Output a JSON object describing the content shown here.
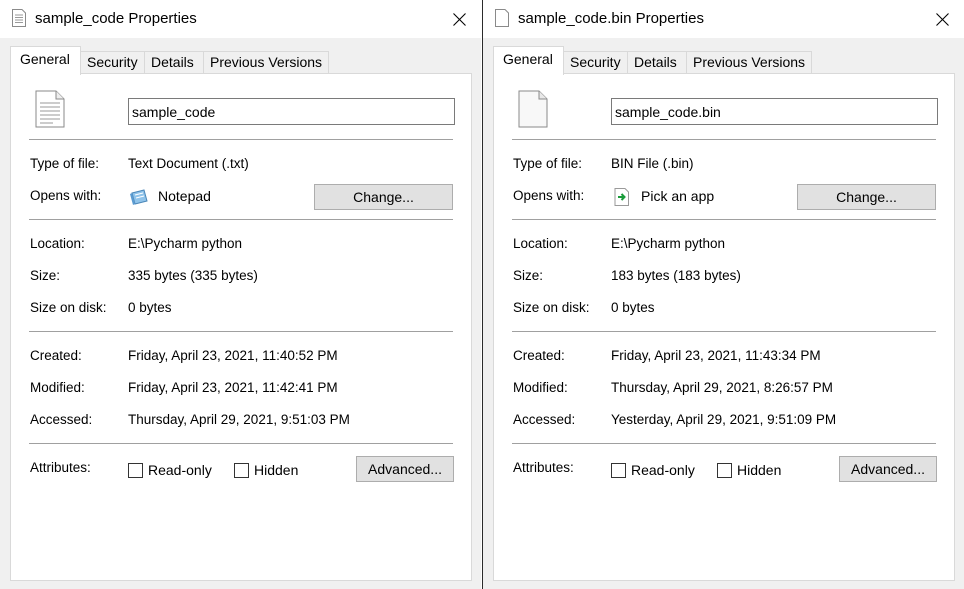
{
  "windows": [
    {
      "title": "sample_code Properties",
      "tabs": [
        "General",
        "Security",
        "Details",
        "Previous Versions"
      ],
      "file_name": "sample_code",
      "icon": "text-document-icon",
      "type_label": "Type of file:",
      "type_value": "Text Document (.txt)",
      "opens_label": "Opens with:",
      "opens_value": "Notepad",
      "opens_icon": "notepad-icon",
      "change_label": "Change...",
      "location_label": "Location:",
      "location_value": "E:\\Pycharm python",
      "size_label": "Size:",
      "size_value": "335 bytes (335 bytes)",
      "disk_label": "Size on disk:",
      "disk_value": "0 bytes",
      "created_label": "Created:",
      "created_value": "Friday, April 23, 2021, 11:40:52 PM",
      "modified_label": "Modified:",
      "modified_value": "Friday, April 23, 2021, 11:42:41 PM",
      "accessed_label": "Accessed:",
      "accessed_value": "Thursday, April 29, 2021, 9:51:03 PM",
      "attributes_label": "Attributes:",
      "readonly_label": "Read-only",
      "hidden_label": "Hidden",
      "advanced_label": "Advanced..."
    },
    {
      "title": "sample_code.bin Properties",
      "tabs": [
        "General",
        "Security",
        "Details",
        "Previous Versions"
      ],
      "file_name": "sample_code.bin",
      "icon": "blank-file-icon",
      "type_label": "Type of file:",
      "type_value": "BIN File (.bin)",
      "opens_label": "Opens with:",
      "opens_value": "Pick an app",
      "opens_icon": "pick-app-icon",
      "change_label": "Change...",
      "location_label": "Location:",
      "location_value": "E:\\Pycharm python",
      "size_label": "Size:",
      "size_value": "183 bytes (183 bytes)",
      "disk_label": "Size on disk:",
      "disk_value": "0 bytes",
      "created_label": "Created:",
      "created_value": "Friday, April 23, 2021, 11:43:34 PM",
      "modified_label": "Modified:",
      "modified_value": "Thursday, April 29, 2021, 8:26:57 PM",
      "accessed_label": "Accessed:",
      "accessed_value": "Yesterday, April 29, 2021, 9:51:09 PM",
      "attributes_label": "Attributes:",
      "readonly_label": "Read-only",
      "hidden_label": "Hidden",
      "advanced_label": "Advanced..."
    }
  ],
  "colors": {
    "window_bg": "#f0f0f0",
    "panel_bg": "#ffffff",
    "button_bg": "#e1e1e1",
    "separator": "#a0a0a0"
  }
}
